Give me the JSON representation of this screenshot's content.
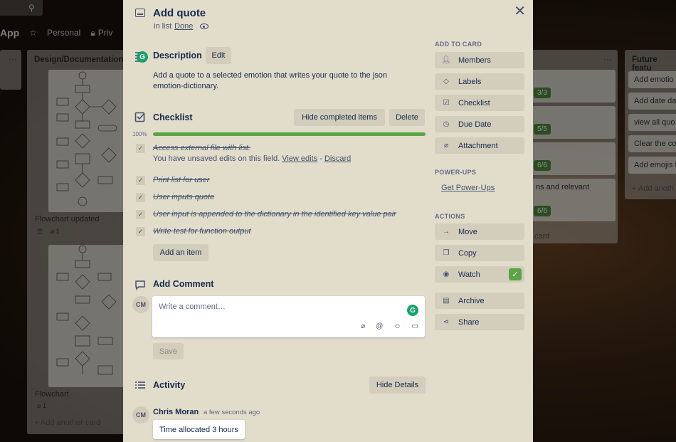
{
  "background": {
    "app_name": "App",
    "team": "Personal",
    "visibility": "Priv",
    "lists": [
      {
        "title": "Design/Documentation"
      },
      {
        "title": "Future featu"
      }
    ],
    "cards": {
      "flowchart_updated": "Flowchart updated",
      "flowchart_updated_attachments": "1",
      "flowchart": "Flowchart",
      "flowchart_attachments": "1",
      "add_another_card_left": "+ Add another card",
      "mid_badge_1": "3/3",
      "mid_badge_2": "5/5",
      "mid_badge_3": "6/6",
      "mid_text": "ns and relevant",
      "mid_badge_4": "6/6",
      "mid_add_card": "card",
      "future_items": [
        "Add emotio",
        "Add date da",
        "view all quo",
        "Clear the co",
        "Add emojis t"
      ],
      "future_add": "+ Add anoth"
    }
  },
  "card": {
    "title": "Add quote",
    "in_list_prefix": "in list",
    "list_name": "Done",
    "description": {
      "heading": "Description",
      "edit_label": "Edit",
      "text": "Add a quote to a selected emotion that writes your quote to the json emotion-dictionary."
    },
    "checklist": {
      "heading": "Checklist",
      "hide_completed_label": "Hide completed items",
      "delete_label": "Delete",
      "progress_label": "100%",
      "progress": 1.0,
      "items": [
        "Access external file with list.",
        "Print list for user",
        "User inputs quote",
        "User input is appended to the dictionary in the identified key value pair",
        "Write test for function output"
      ],
      "unsaved_text": "You have unsaved edits on this field.",
      "view_edits": "View edits",
      "separator": "-",
      "discard": "Discard",
      "add_item_label": "Add an item"
    },
    "comment": {
      "heading": "Add Comment",
      "avatar": "CM",
      "placeholder": "Write a comment…",
      "save_label": "Save"
    },
    "activity": {
      "heading": "Activity",
      "hide_details_label": "Hide Details",
      "avatar": "CM",
      "user": "Chris Moran",
      "time": "a few seconds ago",
      "entry": "Time allocated 3 hours"
    }
  },
  "sidebar": {
    "add_to_card_heading": "ADD TO CARD",
    "add_to_card": [
      {
        "label": "Members",
        "icon": "person-icon"
      },
      {
        "label": "Labels",
        "icon": "tag-icon"
      },
      {
        "label": "Checklist",
        "icon": "checklist-icon"
      },
      {
        "label": "Due Date",
        "icon": "clock-icon"
      },
      {
        "label": "Attachment",
        "icon": "paperclip-icon"
      }
    ],
    "powerups_heading": "POWER-UPS",
    "get_powerups": "Get Power-Ups",
    "actions_heading": "ACTIONS",
    "actions": [
      {
        "label": "Move",
        "icon": "arrow-right-icon"
      },
      {
        "label": "Copy",
        "icon": "copy-icon"
      },
      {
        "label": "Watch",
        "icon": "eye-icon",
        "checked": true
      },
      {
        "label": "Archive",
        "icon": "archive-icon"
      },
      {
        "label": "Share",
        "icon": "share-icon"
      }
    ]
  },
  "colors": {
    "modal_bg": "#e2dccb",
    "button_bg": "#d3cdbc",
    "progress_green": "#5aa544",
    "grammarly_green": "#16a36a"
  }
}
